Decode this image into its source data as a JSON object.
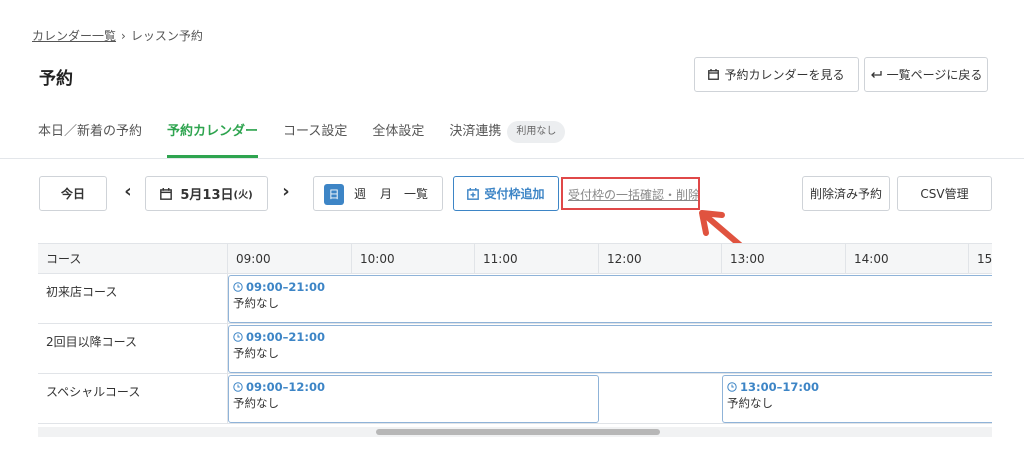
{
  "breadcrumb": {
    "link": "カレンダー一覧",
    "separator": "›",
    "current": "レッスン予約"
  },
  "page": {
    "title": "予約"
  },
  "header_buttons": {
    "view_calendar": "予約カレンダーを見る",
    "back_to_list": "一覧ページに戻る"
  },
  "tabs": [
    {
      "label": "本日／新着の予約",
      "active": false
    },
    {
      "label": "予約カレンダー",
      "active": true
    },
    {
      "label": "コース設定",
      "active": false
    },
    {
      "label": "全体設定",
      "active": false
    },
    {
      "label": "決済連携",
      "active": false,
      "badge": "利用なし"
    }
  ],
  "toolbar": {
    "today": "今日",
    "prev": "‹",
    "next": "›",
    "date_month_day": "5月13日",
    "date_weekday": "(火)",
    "view": {
      "day": "日",
      "week": "週",
      "month": "月",
      "list": "一覧"
    },
    "add_slot": "受付枠追加",
    "bulk_check_delete": "受付枠の一括確認・削除",
    "deleted_reservations": "削除済み予約",
    "csv": "CSV管理"
  },
  "grid": {
    "course_header": "コース",
    "hours": [
      "09:00",
      "10:00",
      "11:00",
      "12:00",
      "13:00",
      "14:00",
      "15"
    ],
    "rows": [
      {
        "course": "初来店コース",
        "slots": [
          {
            "time": "09:00–21:00",
            "note": "予約なし"
          }
        ]
      },
      {
        "course": "2回目以降コース",
        "slots": [
          {
            "time": "09:00–21:00",
            "note": "予約なし"
          }
        ]
      },
      {
        "course": "スペシャルコース",
        "slots": [
          {
            "time": "09:00–12:00",
            "note": "予約なし"
          },
          {
            "time": "13:00–17:00",
            "note": "予約なし"
          }
        ]
      }
    ]
  },
  "colors": {
    "accent_green": "#2ea44f",
    "accent_blue": "#3d85c6",
    "highlight_red": "#e04848",
    "arrow": "#e0533f"
  }
}
